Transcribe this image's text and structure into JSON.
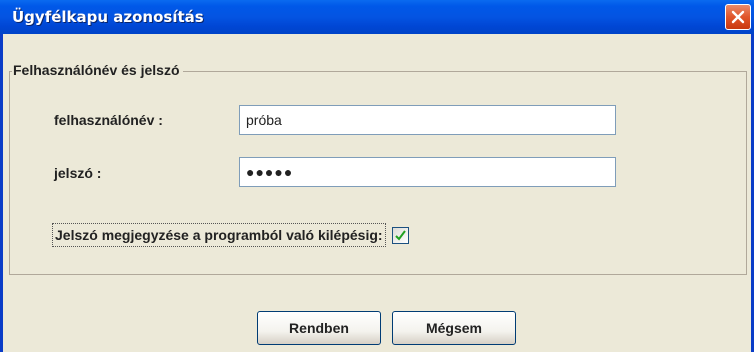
{
  "window": {
    "title": "Ügyfélkapu azonosítás",
    "title_bar_color": "#0454e2",
    "close_button_color": "#e1552a"
  },
  "group": {
    "legend": "Felhasználónév és jelszó"
  },
  "form": {
    "username_label": "felhasználónév :",
    "username_value": "próba",
    "password_label": "jelszó :",
    "password_masked": "●●●●●",
    "remember_label": "Jelszó megjegyzése a programból való kilépésig:",
    "remember_checked": true
  },
  "buttons": {
    "ok_label": "Rendben",
    "cancel_label": "Mégsem"
  }
}
